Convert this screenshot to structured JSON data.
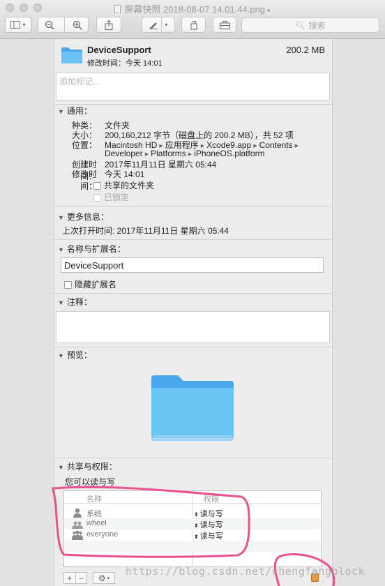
{
  "window": {
    "title": "屏幕快照 2018-08-07 14.01.44.png",
    "search_placeholder": "搜索"
  },
  "header": {
    "name": "DeviceSupport",
    "size": "200.2 MB",
    "modified": "修改时间：今天 14:01",
    "tag_placeholder": "添加标记..."
  },
  "general": {
    "heading": "通用：",
    "kind_label": "种类：",
    "kind_value": "文件夹",
    "size_label": "大小：",
    "size_value": "200,160,212 字节（磁盘上的 200.2 MB），共 52 项",
    "where_label": "位置：",
    "where_path_line1": [
      "Macintosh HD",
      "应用程序",
      "Xcode9.app",
      "Contents"
    ],
    "where_path_line2": [
      "Developer",
      "Platforms",
      "iPhoneOS.platform"
    ],
    "created_label": "创建时间：",
    "created_value": "2017年11月11日 星期六 05:44",
    "modified_label": "修改时间：",
    "modified_value": "今天 14:01",
    "shared_folder": "共享的文件夹",
    "locked": "已锁定"
  },
  "more_info": {
    "heading": "更多信息：",
    "last_opened": "上次打开时间: 2017年11月11日 星期六 05:44"
  },
  "name_ext": {
    "heading": "名称与扩展名：",
    "value": "DeviceSupport",
    "hide_ext": "隐藏扩展名"
  },
  "comments": {
    "heading": "注释："
  },
  "preview": {
    "heading": "预览："
  },
  "sharing": {
    "heading": "共享与权限：",
    "summary": "您可以读与写",
    "col_name": "名称",
    "col_priv": "权限",
    "rows": [
      {
        "name": "系统",
        "privilege": "读与写",
        "icon": "single-user-icon"
      },
      {
        "name": "wheel",
        "privilege": "读与写",
        "icon": "group-icon"
      },
      {
        "name": "everyone",
        "privilege": "读与写",
        "icon": "everyone-icon"
      }
    ]
  },
  "watermark": "https://blog.csdn.net/chengfangblock",
  "colors": {
    "annotation": "#e8508f",
    "folder": "#5eb6ef",
    "lock": "#e69a3c"
  }
}
